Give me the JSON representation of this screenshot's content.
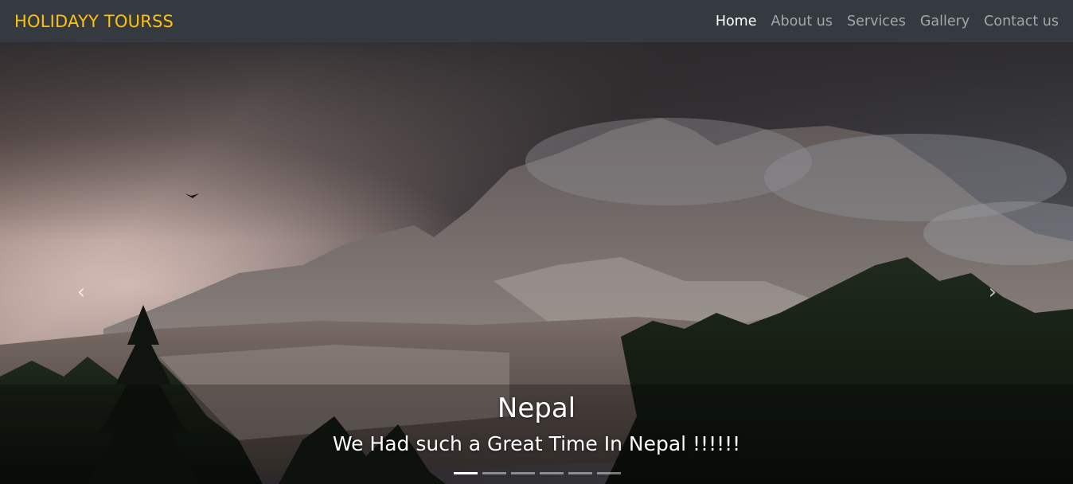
{
  "navbar": {
    "brand": "HOLIDAYY TOURSS",
    "links": [
      "Home",
      "About us",
      "Services",
      "Gallery",
      "Contact us"
    ],
    "active_link": "Home",
    "brand_color": "#ffc107",
    "background": "#343a40"
  },
  "carousel": {
    "caption_title": "Nepal",
    "caption_text": "We Had such a Great Time In Nepal !!!!!!",
    "prev_icon": "chevron-left-icon",
    "next_icon": "chevron-right-icon",
    "slide_count": 6,
    "active_slide": 1
  }
}
